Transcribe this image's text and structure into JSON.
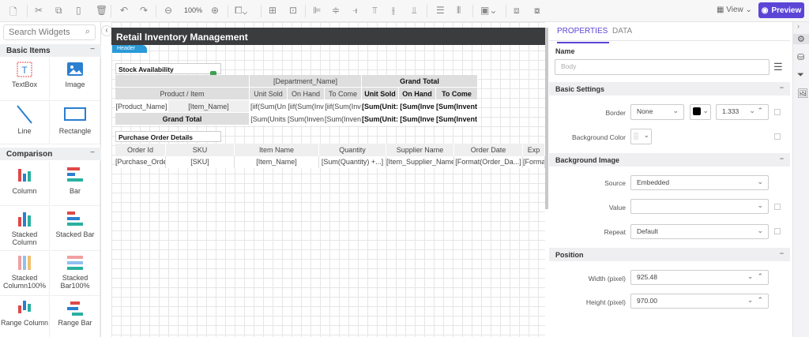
{
  "toolbar": {
    "zoom": "100%",
    "view_label": "View",
    "preview_label": "Preview"
  },
  "left_panel": {
    "search_placeholder": "Search Widgets",
    "sections": [
      {
        "title": "Basic Items",
        "items": [
          "TextBox",
          "Image",
          "Line",
          "Rectangle"
        ]
      },
      {
        "title": "Comparison",
        "items": [
          "Column",
          "Bar",
          "Stacked Column",
          "Stacked Bar",
          "Stacked Column100%",
          "Stacked Bar100%",
          "Range Column",
          "Range Bar"
        ]
      }
    ]
  },
  "report": {
    "title": "Retail Inventory Management",
    "header_tab": "Header",
    "stock": {
      "title": "Stock Availability",
      "dept": "[Department_Name]",
      "grand_total": "Grand Total",
      "product_item": "Product / Item",
      "cols": [
        "Unit Sold",
        "On Hand",
        "To Come",
        "Unit Sold",
        "On Hand",
        "To Come"
      ],
      "row": [
        "[Product_Name]",
        "[Item_Name]",
        "[iif(Sum(Un",
        "[iif(Sum(Inv",
        "[iif(Sum(Inv",
        "[Sum(Unit:",
        "[Sum(Inve",
        "[Sum(Invent"
      ],
      "total_row": [
        "Grand Total",
        "[Sum(Units",
        "[Sum(Inven",
        "[Sum(Inven",
        "[Sum(Unit:",
        "[Sum(Inve",
        "[Sum(Invent"
      ]
    },
    "purchase": {
      "title": "Purchase Order Details",
      "headers": [
        "Order Id",
        "SKU",
        "Item Name",
        "Quantity",
        "Supplier Name",
        "Order Date",
        "Exp"
      ],
      "row": [
        "[Purchase_Orde",
        "[SKU]",
        "[Item_Name]",
        "[Sum(Quantity) +...]",
        "[Item_Supplier_Name",
        "[Format(Order_Da...]",
        "[Forma"
      ]
    }
  },
  "properties": {
    "tabs": [
      "PROPERTIES",
      "DATA"
    ],
    "name_label": "Name",
    "name_placeholder": "Body",
    "basic_settings": "Basic Settings",
    "border_label": "Border",
    "border_style": "None",
    "border_width": "1.333",
    "bg_color_label": "Background Color",
    "bg_image": "Background Image",
    "source_label": "Source",
    "source": "Embedded",
    "value_label": "Value",
    "value": "",
    "repeat_label": "Repeat",
    "repeat": "Default",
    "position": "Position",
    "width_label": "Width (pixel)",
    "width": "925.48",
    "height_label": "Height (pixel)",
    "height": "970.00"
  },
  "colors": {
    "accent": "#5b45d6",
    "header_bar": "#3b3c3e",
    "header_tab": "#2a9ad8"
  }
}
